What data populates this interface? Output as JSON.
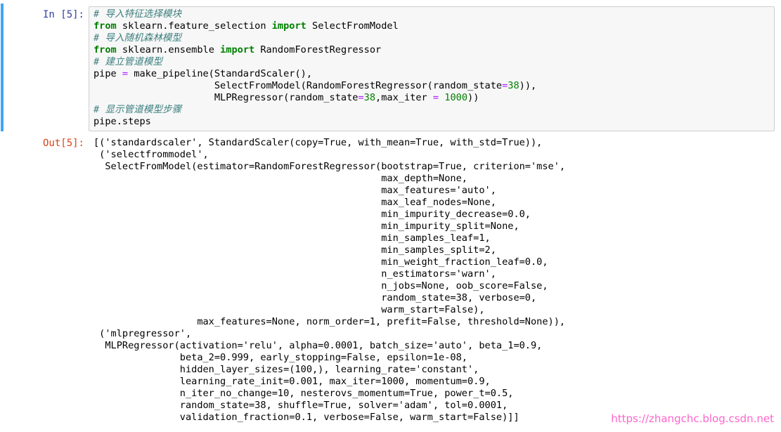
{
  "input_cell": {
    "prompt": "In [5]:",
    "code_lines": [
      [
        {
          "t": "# 导入特征选择模块",
          "c": "cm"
        }
      ],
      [
        {
          "t": "from",
          "c": "kw"
        },
        {
          "t": " sklearn.feature_selection "
        },
        {
          "t": "import",
          "c": "kw"
        },
        {
          "t": " SelectFromModel"
        }
      ],
      [
        {
          "t": "# 导入随机森林模型",
          "c": "cm"
        }
      ],
      [
        {
          "t": "from",
          "c": "kw"
        },
        {
          "t": " sklearn.ensemble "
        },
        {
          "t": "import",
          "c": "kw"
        },
        {
          "t": " RandomForestRegressor"
        }
      ],
      [
        {
          "t": "# 建立管道模型",
          "c": "cm"
        }
      ],
      [
        {
          "t": "pipe "
        },
        {
          "t": "=",
          "c": "op"
        },
        {
          "t": " make_pipeline(StandardScaler(),"
        }
      ],
      [
        {
          "t": "                     SelectFromModel(RandomForestRegressor(random_state"
        },
        {
          "t": "=",
          "c": "op"
        },
        {
          "t": "38",
          "c": "num"
        },
        {
          "t": ")),"
        }
      ],
      [
        {
          "t": "                     MLPRegressor(random_state"
        },
        {
          "t": "=",
          "c": "op"
        },
        {
          "t": "38",
          "c": "num"
        },
        {
          "t": ",max_iter "
        },
        {
          "t": "=",
          "c": "op"
        },
        {
          "t": " "
        },
        {
          "t": "1000",
          "c": "num"
        },
        {
          "t": "))"
        }
      ],
      [
        {
          "t": "# 显示管道模型步骤",
          "c": "cm"
        }
      ],
      [
        {
          "t": "pipe.steps"
        }
      ]
    ]
  },
  "output_cell": {
    "prompt": "Out[5]:",
    "lines": [
      "[('standardscaler', StandardScaler(copy=True, with_mean=True, with_std=True)),",
      " ('selectfrommodel',",
      "  SelectFromModel(estimator=RandomForestRegressor(bootstrap=True, criterion='mse',",
      "                                                  max_depth=None,",
      "                                                  max_features='auto',",
      "                                                  max_leaf_nodes=None,",
      "                                                  min_impurity_decrease=0.0,",
      "                                                  min_impurity_split=None,",
      "                                                  min_samples_leaf=1,",
      "                                                  min_samples_split=2,",
      "                                                  min_weight_fraction_leaf=0.0,",
      "                                                  n_estimators='warn',",
      "                                                  n_jobs=None, oob_score=False,",
      "                                                  random_state=38, verbose=0,",
      "                                                  warm_start=False),",
      "                  max_features=None, norm_order=1, prefit=False, threshold=None)),",
      " ('mlpregressor',",
      "  MLPRegressor(activation='relu', alpha=0.0001, batch_size='auto', beta_1=0.9,",
      "               beta_2=0.999, early_stopping=False, epsilon=1e-08,",
      "               hidden_layer_sizes=(100,), learning_rate='constant',",
      "               learning_rate_init=0.001, max_iter=1000, momentum=0.9,",
      "               n_iter_no_change=10, nesterovs_momentum=True, power_t=0.5,",
      "               random_state=38, shuffle=True, solver='adam', tol=0.0001,",
      "               validation_fraction=0.1, verbose=False, warm_start=False)]]"
    ]
  },
  "watermark": "https://zhangchc.blog.csdn.net",
  "colors": {
    "in_prompt": "#303F9F",
    "out_prompt": "#D84315",
    "selected_bar": "#42A5F5",
    "comment": "#408080",
    "keyword": "#008000",
    "operator": "#AA22FF",
    "watermark": "#FF66CC"
  }
}
